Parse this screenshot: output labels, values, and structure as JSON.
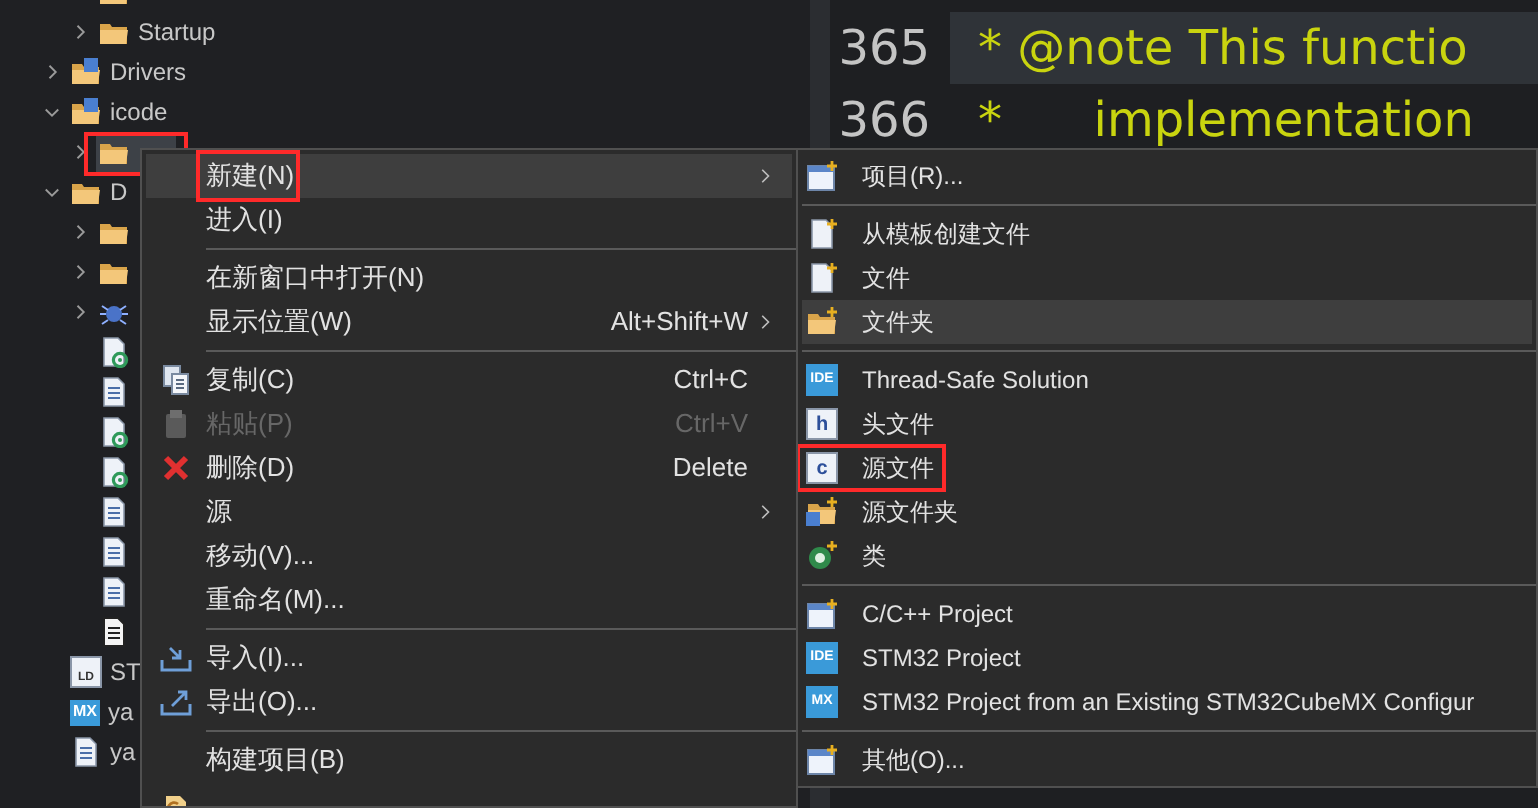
{
  "explorer": {
    "continued_rows": [
      {
        "kind": "folder"
      },
      {
        "kind": "folder",
        "label": "Startup",
        "expanded": false,
        "selected": false
      }
    ],
    "items": [
      {
        "kind": "source-folder",
        "label": "Drivers",
        "expanded": false,
        "selected": false
      },
      {
        "kind": "source-folder",
        "label": "icode",
        "expanded": true,
        "selected": false,
        "children": [
          {
            "kind": "folder",
            "expanded": false,
            "selected": true,
            "callout": true
          }
        ]
      },
      {
        "kind": "folder",
        "label": "D",
        "expanded": true,
        "selected": false,
        "children": [
          {
            "kind": "folder",
            "expanded": false,
            "selected": false
          },
          {
            "kind": "folder",
            "expanded": false,
            "selected": false
          },
          {
            "kind": "debug",
            "expanded": false,
            "selected": false
          },
          {
            "kind": "file-gear",
            "selected": false
          },
          {
            "kind": "file",
            "selected": false
          },
          {
            "kind": "file-gear",
            "selected": false
          },
          {
            "kind": "file-gear",
            "selected": false
          },
          {
            "kind": "file",
            "selected": false
          },
          {
            "kind": "file",
            "selected": false
          },
          {
            "kind": "file",
            "selected": false
          },
          {
            "kind": "text-file",
            "selected": false
          }
        ]
      },
      {
        "kind": "ld",
        "badge": "LD",
        "label": "ST",
        "selected": false
      },
      {
        "kind": "mx",
        "badge": "MX",
        "label": "ya",
        "selected": false
      },
      {
        "kind": "file",
        "label": "ya",
        "selected": false
      }
    ]
  },
  "editor": {
    "lines": [
      {
        "number": "365",
        "text": "* @note This functio",
        "current": true
      },
      {
        "number": "366",
        "text": "*      implementation",
        "current": false
      }
    ]
  },
  "context_menu": {
    "items": [
      {
        "kind": "item",
        "label": "新建(N)",
        "submenu": true,
        "highlighted": true,
        "disabled": false,
        "callout": true
      },
      {
        "kind": "item",
        "label": "进入(I)",
        "highlighted": false,
        "disabled": false
      },
      {
        "kind": "separator"
      },
      {
        "kind": "item",
        "label": "在新窗口中打开(N)",
        "highlighted": false,
        "disabled": false
      },
      {
        "kind": "item",
        "label": "显示位置(W)",
        "shortcut": "Alt+Shift+W",
        "submenu": true,
        "highlighted": false,
        "disabled": false
      },
      {
        "kind": "separator"
      },
      {
        "kind": "item",
        "label": "复制(C)",
        "shortcut": "Ctrl+C",
        "highlighted": false,
        "disabled": false
      },
      {
        "kind": "item",
        "label": "粘贴(P)",
        "shortcut": "Ctrl+V",
        "highlighted": false,
        "disabled": true
      },
      {
        "kind": "item",
        "label": "删除(D)",
        "shortcut": "Delete",
        "highlighted": false,
        "disabled": false
      },
      {
        "kind": "item",
        "label": "源",
        "submenu": true,
        "highlighted": false,
        "disabled": false
      },
      {
        "kind": "item",
        "label": "移动(V)...",
        "highlighted": false,
        "disabled": false
      },
      {
        "kind": "item",
        "label": "重命名(M)...",
        "highlighted": false,
        "disabled": false
      },
      {
        "kind": "separator"
      },
      {
        "kind": "item",
        "label": "导入(I)...",
        "highlighted": false,
        "disabled": false
      },
      {
        "kind": "item",
        "label": "导出(O)...",
        "highlighted": false,
        "disabled": false
      },
      {
        "kind": "separator"
      },
      {
        "kind": "item",
        "label": "构建项目(B)",
        "highlighted": false,
        "disabled": false
      },
      {
        "kind": "item",
        "highlighted": false
      }
    ]
  },
  "submenu": {
    "items": [
      {
        "kind": "item",
        "label": "项目(R)...",
        "highlighted": false
      },
      {
        "kind": "separator"
      },
      {
        "kind": "item",
        "label": "从模板创建文件",
        "highlighted": false
      },
      {
        "kind": "item",
        "label": "文件",
        "highlighted": false
      },
      {
        "kind": "item",
        "label": "文件夹",
        "highlighted": true
      },
      {
        "kind": "separator"
      },
      {
        "kind": "item",
        "badge": "IDE",
        "label": "Thread-Safe Solution",
        "highlighted": false
      },
      {
        "kind": "item",
        "badge": "h",
        "label": "头文件",
        "highlighted": false
      },
      {
        "kind": "item",
        "badge": "c",
        "label": "源文件",
        "highlighted": false,
        "callout": true
      },
      {
        "kind": "item",
        "label": "源文件夹",
        "highlighted": false
      },
      {
        "kind": "item",
        "label": "类",
        "highlighted": false
      },
      {
        "kind": "separator"
      },
      {
        "kind": "item",
        "label": "C/C++ Project",
        "highlighted": false
      },
      {
        "kind": "item",
        "badge": "IDE",
        "label": "STM32 Project",
        "highlighted": false
      },
      {
        "kind": "item",
        "badge": "MX",
        "label": "STM32 Project from an Existing STM32CubeMX Configur",
        "highlighted": false
      },
      {
        "kind": "separator"
      },
      {
        "kind": "item",
        "label": "其他(O)...",
        "highlighted": false
      }
    ]
  }
}
